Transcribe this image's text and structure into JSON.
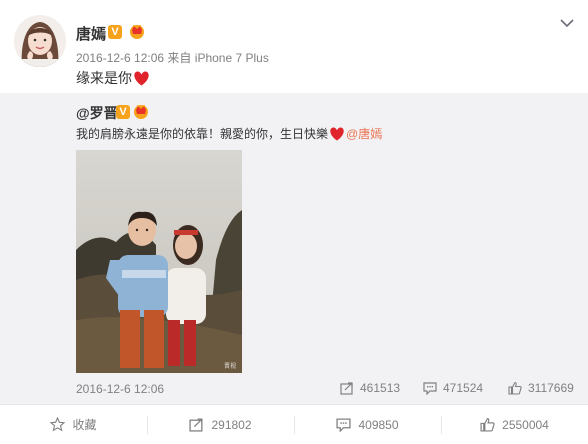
{
  "post": {
    "author": "唐嫣",
    "verified_badge": "V",
    "member_badge": "crown-badge-icon",
    "timestamp": "2016-12-6 12:06",
    "source_prefix": "来自",
    "source": "iPhone 7 Plus",
    "text": "缘来是你"
  },
  "repost": {
    "author": "@罗晋",
    "verified_badge": "V",
    "text_main": "我的肩膀永遠是你的依靠！親愛的你，生日快樂",
    "mention": "@唐嫣",
    "photo_watermark": "晋视",
    "timestamp": "2016-12-6 12:06",
    "forward_count": "461513",
    "comment_count": "471524",
    "like_count": "3117669"
  },
  "actions": {
    "favorite_label": "收藏",
    "forward_count": "291802",
    "comment_count": "409850",
    "like_count": "2550004"
  },
  "colors": {
    "accent_orange": "#eb7350",
    "verified": "#f7a21b",
    "heart": "#e0242c",
    "meta_gray": "#808080",
    "repost_bg": "#f2f2f5"
  }
}
